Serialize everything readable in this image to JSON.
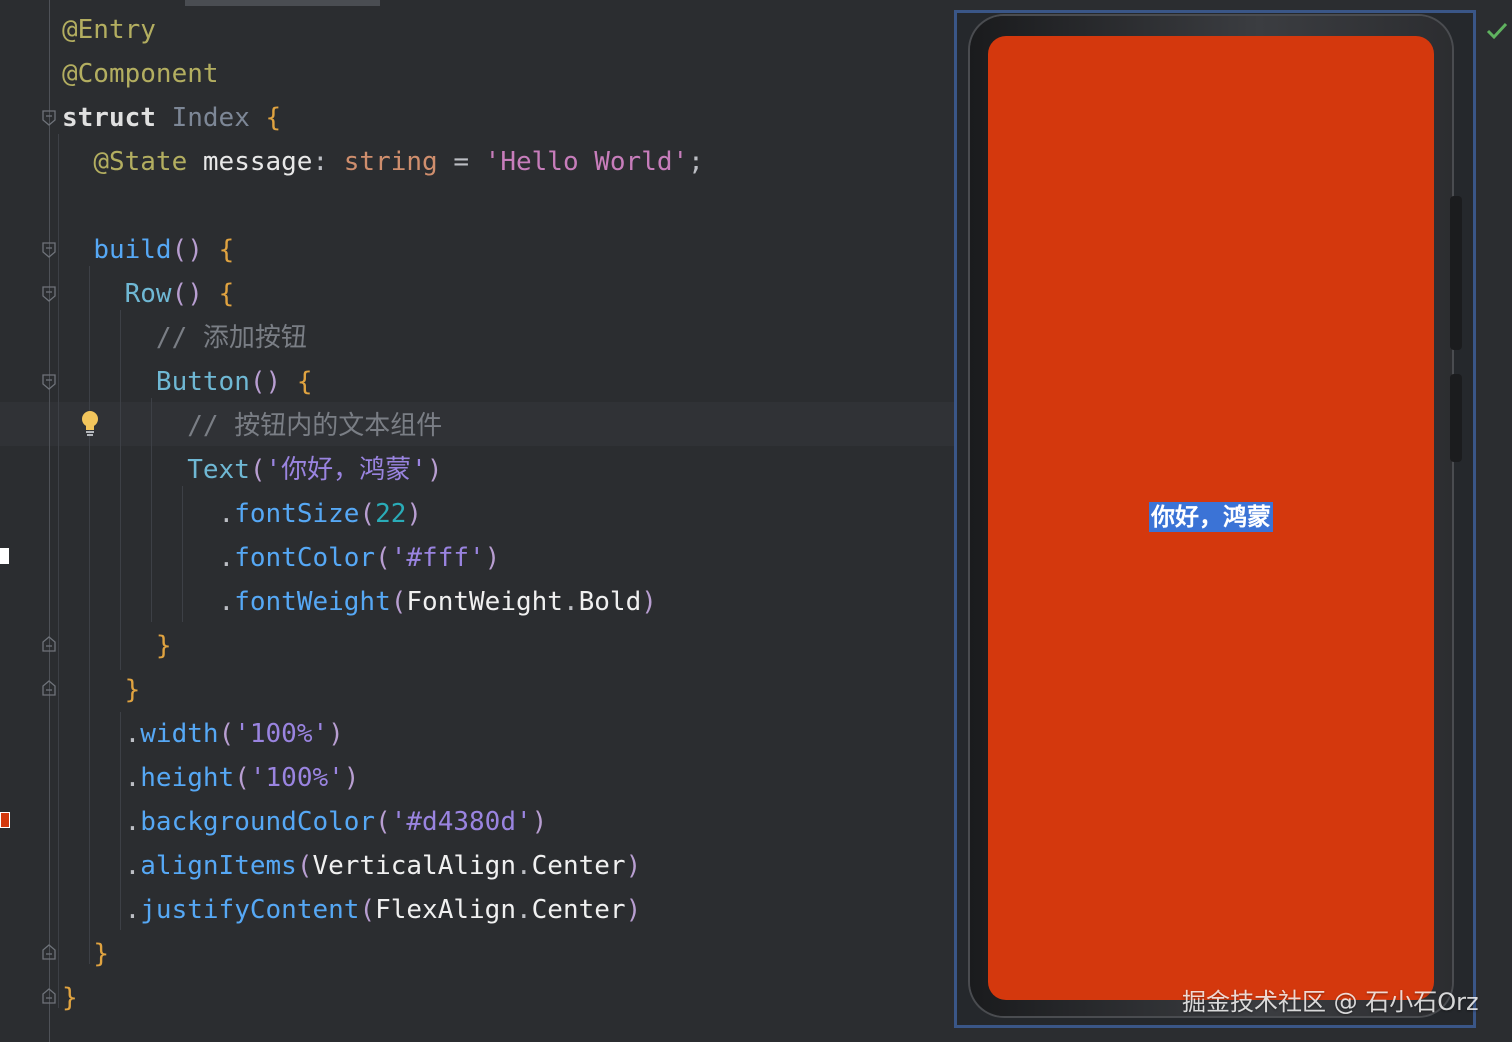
{
  "code": {
    "lines": [
      [
        {
          "t": "@Entry",
          "c": "t-ann"
        }
      ],
      [
        {
          "t": "@Component",
          "c": "t-ann"
        }
      ],
      [
        {
          "t": "struct",
          "c": "t-kwb"
        },
        {
          "t": " "
        },
        {
          "t": "Index",
          "c": "t-type"
        },
        {
          "t": " "
        },
        {
          "t": "{",
          "c": "t-brace"
        }
      ],
      [
        {
          "t": "  "
        },
        {
          "t": "@State",
          "c": "t-ann"
        },
        {
          "t": " "
        },
        {
          "t": "message",
          "c": "t-id"
        },
        {
          "t": ": ",
          "c": "t-punct"
        },
        {
          "t": "string",
          "c": "t-kw"
        },
        {
          "t": " = ",
          "c": "t-punct"
        },
        {
          "t": "'Hello World'",
          "c": "t-str"
        },
        {
          "t": ";",
          "c": "t-punct"
        }
      ],
      [],
      [
        {
          "t": "  "
        },
        {
          "t": "build",
          "c": "t-fn"
        },
        {
          "t": "() ",
          "c": "t-par"
        },
        {
          "t": "{",
          "c": "t-brace"
        }
      ],
      [
        {
          "t": "    "
        },
        {
          "t": "Row",
          "c": "t-comp"
        },
        {
          "t": "() ",
          "c": "t-par"
        },
        {
          "t": "{",
          "c": "t-brace"
        }
      ],
      [
        {
          "t": "      "
        },
        {
          "t": "// 添加按钮",
          "c": "t-comm"
        }
      ],
      [
        {
          "t": "      "
        },
        {
          "t": "Button",
          "c": "t-comp"
        },
        {
          "t": "() ",
          "c": "t-par"
        },
        {
          "t": "{",
          "c": "t-brace"
        }
      ],
      [
        {
          "t": "        "
        },
        {
          "t": "// 按钮内的文本组件",
          "c": "t-comm"
        }
      ],
      [
        {
          "t": "        "
        },
        {
          "t": "Text",
          "c": "t-comp"
        },
        {
          "t": "(",
          "c": "t-par"
        },
        {
          "t": "'你好，鸿蒙'",
          "c": "t-strv"
        },
        {
          "t": ")",
          "c": "t-par"
        }
      ],
      [
        {
          "t": "          "
        },
        {
          "t": ".",
          "c": "t-punct"
        },
        {
          "t": "fontSize",
          "c": "t-fn"
        },
        {
          "t": "(",
          "c": "t-par"
        },
        {
          "t": "22",
          "c": "t-num"
        },
        {
          "t": ")",
          "c": "t-par"
        }
      ],
      [
        {
          "t": "          "
        },
        {
          "t": ".",
          "c": "t-punct"
        },
        {
          "t": "fontColor",
          "c": "t-fn"
        },
        {
          "t": "(",
          "c": "t-par"
        },
        {
          "t": "'#fff'",
          "c": "t-strv"
        },
        {
          "t": ")",
          "c": "t-par"
        }
      ],
      [
        {
          "t": "          "
        },
        {
          "t": ".",
          "c": "t-punct"
        },
        {
          "t": "fontWeight",
          "c": "t-fn"
        },
        {
          "t": "(",
          "c": "t-par"
        },
        {
          "t": "FontWeight",
          "c": "t-enum"
        },
        {
          "t": ".",
          "c": "t-punct"
        },
        {
          "t": "Bold",
          "c": "t-enum"
        },
        {
          "t": ")",
          "c": "t-par"
        }
      ],
      [
        {
          "t": "      "
        },
        {
          "t": "}",
          "c": "t-brace"
        }
      ],
      [
        {
          "t": "    "
        },
        {
          "t": "}",
          "c": "t-brace"
        }
      ],
      [
        {
          "t": "    "
        },
        {
          "t": ".",
          "c": "t-punct"
        },
        {
          "t": "width",
          "c": "t-fn"
        },
        {
          "t": "(",
          "c": "t-par"
        },
        {
          "t": "'100%'",
          "c": "t-strv"
        },
        {
          "t": ")",
          "c": "t-par"
        }
      ],
      [
        {
          "t": "    "
        },
        {
          "t": ".",
          "c": "t-punct"
        },
        {
          "t": "height",
          "c": "t-fn"
        },
        {
          "t": "(",
          "c": "t-par"
        },
        {
          "t": "'100%'",
          "c": "t-strv"
        },
        {
          "t": ")",
          "c": "t-par"
        }
      ],
      [
        {
          "t": "    "
        },
        {
          "t": ".",
          "c": "t-punct"
        },
        {
          "t": "backgroundColor",
          "c": "t-fn"
        },
        {
          "t": "(",
          "c": "t-par"
        },
        {
          "t": "'#d4380d'",
          "c": "t-strv"
        },
        {
          "t": ")",
          "c": "t-par"
        }
      ],
      [
        {
          "t": "    "
        },
        {
          "t": ".",
          "c": "t-punct"
        },
        {
          "t": "alignItems",
          "c": "t-fn"
        },
        {
          "t": "(",
          "c": "t-par"
        },
        {
          "t": "VerticalAlign",
          "c": "t-enum"
        },
        {
          "t": ".",
          "c": "t-punct"
        },
        {
          "t": "Center",
          "c": "t-enum"
        },
        {
          "t": ")",
          "c": "t-par"
        }
      ],
      [
        {
          "t": "    "
        },
        {
          "t": ".",
          "c": "t-punct"
        },
        {
          "t": "justifyContent",
          "c": "t-fn"
        },
        {
          "t": "(",
          "c": "t-par"
        },
        {
          "t": "FlexAlign",
          "c": "t-enum"
        },
        {
          "t": ".",
          "c": "t-punct"
        },
        {
          "t": "Center",
          "c": "t-enum"
        },
        {
          "t": ")",
          "c": "t-par"
        }
      ],
      [
        {
          "t": "  "
        },
        {
          "t": "}",
          "c": "t-brace"
        }
      ],
      [
        {
          "t": "}",
          "c": "t-brace"
        }
      ]
    ]
  },
  "preview": {
    "text": "你好，鸿蒙",
    "background": "#d4380d",
    "text_color": "#ffffff",
    "selection_color": "#3b73d6"
  },
  "watermark": "掘金技术社区 @ 石小石Orz",
  "icons": {
    "status": "check-icon",
    "intention": "lightbulb-icon"
  }
}
